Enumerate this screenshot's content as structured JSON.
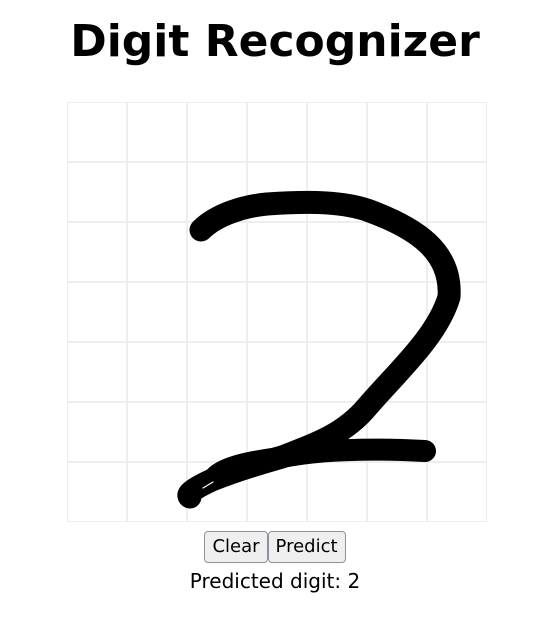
{
  "page": {
    "title": "Digit Recognizer"
  },
  "canvas": {
    "grid_color": "#eeeeee",
    "stroke_color": "#000000",
    "digit_drawn": "2"
  },
  "buttons": {
    "clear_label": "Clear",
    "predict_label": "Predict"
  },
  "result": {
    "text": "Predicted digit: 2"
  }
}
